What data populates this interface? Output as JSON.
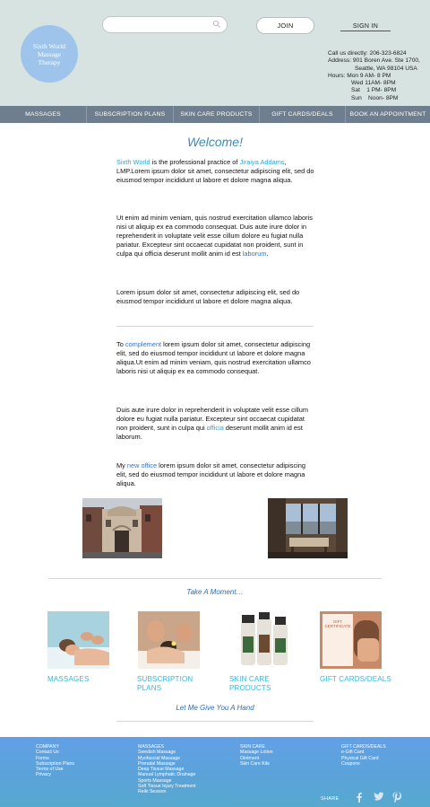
{
  "header": {
    "logo_lines": [
      "Sixth World",
      "Massage",
      "Therapy"
    ],
    "search_placeholder": "",
    "join_label": "JOIN",
    "signin_label": "SIGN IN",
    "contact_lines": [
      "Call us directly: 206-323-6824",
      "Address: 901 Boren Ave. Ste 1700,",
      "Seattle, WA 98104 USA",
      "Hours: Mon 9 AM- 8 PM",
      "Wed 11AM- 8PM",
      "Sat    1 PM- 8PM",
      "Sun    Noon- 8PM"
    ]
  },
  "nav": [
    "MASSAGES",
    "SUBSCRIPTION PLANS",
    "SKIN CARE PRODUCTS",
    "GIFT CARDS/DEALS",
    "BOOK AN APPOINTMENT"
  ],
  "main": {
    "title": "Welcome!",
    "p1": {
      "link1": "Sixth World",
      "t1": " is the professional practice of ",
      "link2": "Jiraiya Addams",
      "t2": ", LMP.Lorem ipsum dolor sit amet, consectetur adipiscing elit, sed do eiusmod tempor incididunt ut labore et dolore magna aliqua."
    },
    "p2": {
      "t1": "Ut enim ad minim veniam, quis nostrud exercitation ullamco laboris nisi ut aliquip ex ea commodo consequat. Duis aute irure dolor in reprehenderit in voluptate velit esse cillum dolore eu fugiat nulla pariatur. Excepteur sint occaecat cupidatat non proident, sunt in culpa qui officia deserunt mollit anim id est ",
      "link": "laborum",
      "t2": "."
    },
    "p3": "Lorem ipsum dolor sit amet, consectetur adipiscing elit, sed do eiusmod tempor incididunt ut labore et dolore magna aliqua.",
    "p4": {
      "t1": "To ",
      "link": "complement",
      "t2": " lorem ipsum dolor sit amet, consectetur adipiscing elit, sed do eiusmod tempor incididunt ut labore et dolore magna aliqua.Ut enim ad minim veniam, quis nostrud exercitation ullamco laboris nisi ut aliquip ex ea commodo consequat."
    },
    "p5": {
      "t1": "Duis aute irure dolor in reprehenderit in voluptate velit esse cillum dolore eu fugiat nulla pariatur. Excepteur sint occaecat cupidatat non proident, sunt in culpa qui ",
      "link": "officia",
      "t2": " deserunt mollit anim id est laborum."
    },
    "p6": {
      "t1": "My ",
      "link": "new office",
      "t2": " lorem ipsum dolor sit amet, consectetur adipiscing elit, sed do eiusmod tempor incididunt ut labore et dolore magna aliqua."
    }
  },
  "take_moment": "Take A Moment…",
  "cards": [
    {
      "label1": "MASSAGES",
      "label2": ""
    },
    {
      "label1": "SUBSCRIPTION",
      "label2": "PLANS"
    },
    {
      "label1": "SKIN CARE",
      "label2": "PRODUCTS"
    },
    {
      "label1": "GIFT CARDS/DEALS",
      "label2": ""
    }
  ],
  "gift_text": [
    "GIFT",
    "CERTIFICATE"
  ],
  "give_hand": "Let Me Give You A Hand",
  "footer": {
    "columns": [
      [
        "COMPANY",
        "Contact Us",
        "Forms",
        "Subscription Plans",
        "Terms of Use",
        "Privacy"
      ],
      [
        "MASSAGES",
        "Swedish Massage",
        "Myofascial Massage",
        "Prenatal Massage",
        "Deep Tissue Massage",
        "Manual Lymphatic Drainage",
        "Sports Massage",
        "Soft Tissue Injury Treatment",
        "Reiki Session"
      ],
      [
        "SKIN CARE",
        "Massage Lotion",
        "Ointment",
        "Skin Care Kits"
      ],
      [
        "GIFT CARDS/DEALS",
        "e-Gift Card",
        "Physical Gift Card",
        "Coupons"
      ]
    ],
    "share_label": "SHARE"
  }
}
